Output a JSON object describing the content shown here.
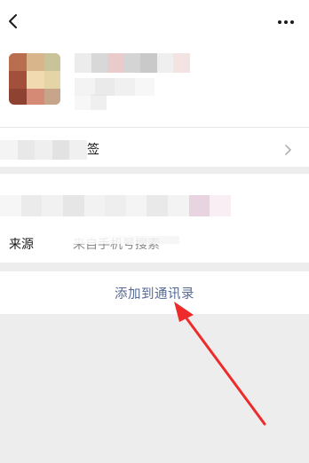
{
  "profile": {
    "back_icon": "chevron-left-icon",
    "more_icon": "ellipsis-icon",
    "avatar_colors": [
      "#c98c6a",
      "#d9a07b",
      "#e8c9a0",
      "#b3745a"
    ]
  },
  "tags_row": {
    "label_fragment": "签",
    "chevron_icon": "chevron-right-icon"
  },
  "source_row": {
    "label": "来源",
    "value": "来自手机号搜索"
  },
  "action": {
    "label": "添加到通讯录"
  },
  "annotation": {
    "arrow_color": "#ee2b2b"
  },
  "colors": {
    "link_blue": "#576b95",
    "page_bg": "#ededed"
  }
}
